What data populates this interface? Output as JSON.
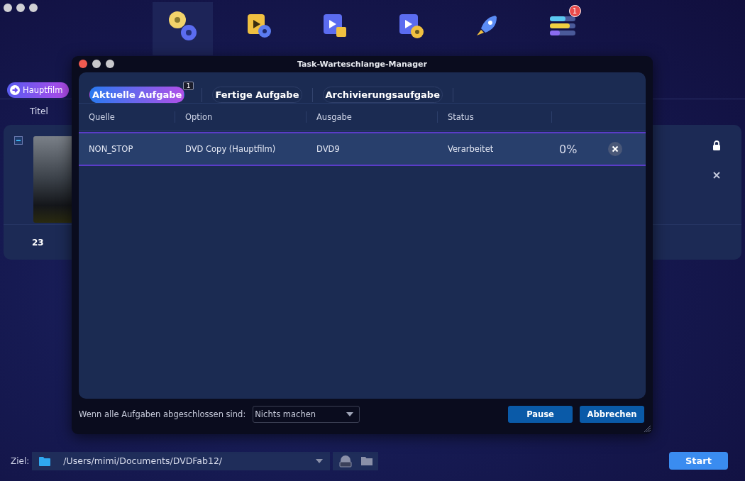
{
  "toolbar": [
    {
      "kind": "copy",
      "selected": true
    },
    {
      "kind": "ripper",
      "selected": false
    },
    {
      "kind": "converter",
      "selected": false
    },
    {
      "kind": "creator",
      "selected": false
    },
    {
      "kind": "launchpad",
      "selected": false
    },
    {
      "kind": "task-manager",
      "selected": false,
      "badge": "1"
    }
  ],
  "mode_button": "Hauptfilm",
  "title_column": "Titel",
  "title_card": {
    "checked": true,
    "duration": "23"
  },
  "destination": {
    "label": "Ziel:",
    "path": "/Users/mimi/Documents/DVDFab12/"
  },
  "start_button": "Start",
  "dialog": {
    "title": "Task-Warteschlange-Manager",
    "tabs": [
      {
        "label": "Aktuelle Aufgabe",
        "selected": true,
        "badge": "1"
      },
      {
        "label": "Fertige Aufgabe",
        "selected": false
      },
      {
        "label": "Archivierungsaufgabe",
        "selected": false
      }
    ],
    "columns": [
      "Quelle",
      "Option",
      "Ausgabe",
      "Status"
    ],
    "rows": [
      {
        "source": "NON_STOP",
        "option": "DVD Copy (Hauptfilm)",
        "output": "DVD9",
        "status": "Verarbeitet",
        "progress": "0%",
        "selected": true
      }
    ],
    "footer": {
      "label": "Wenn alle Aufgaben abgeschlossen sind:",
      "dropdown": "Nichts machen"
    },
    "buttons": [
      "Pause",
      "Abbrechen"
    ]
  }
}
